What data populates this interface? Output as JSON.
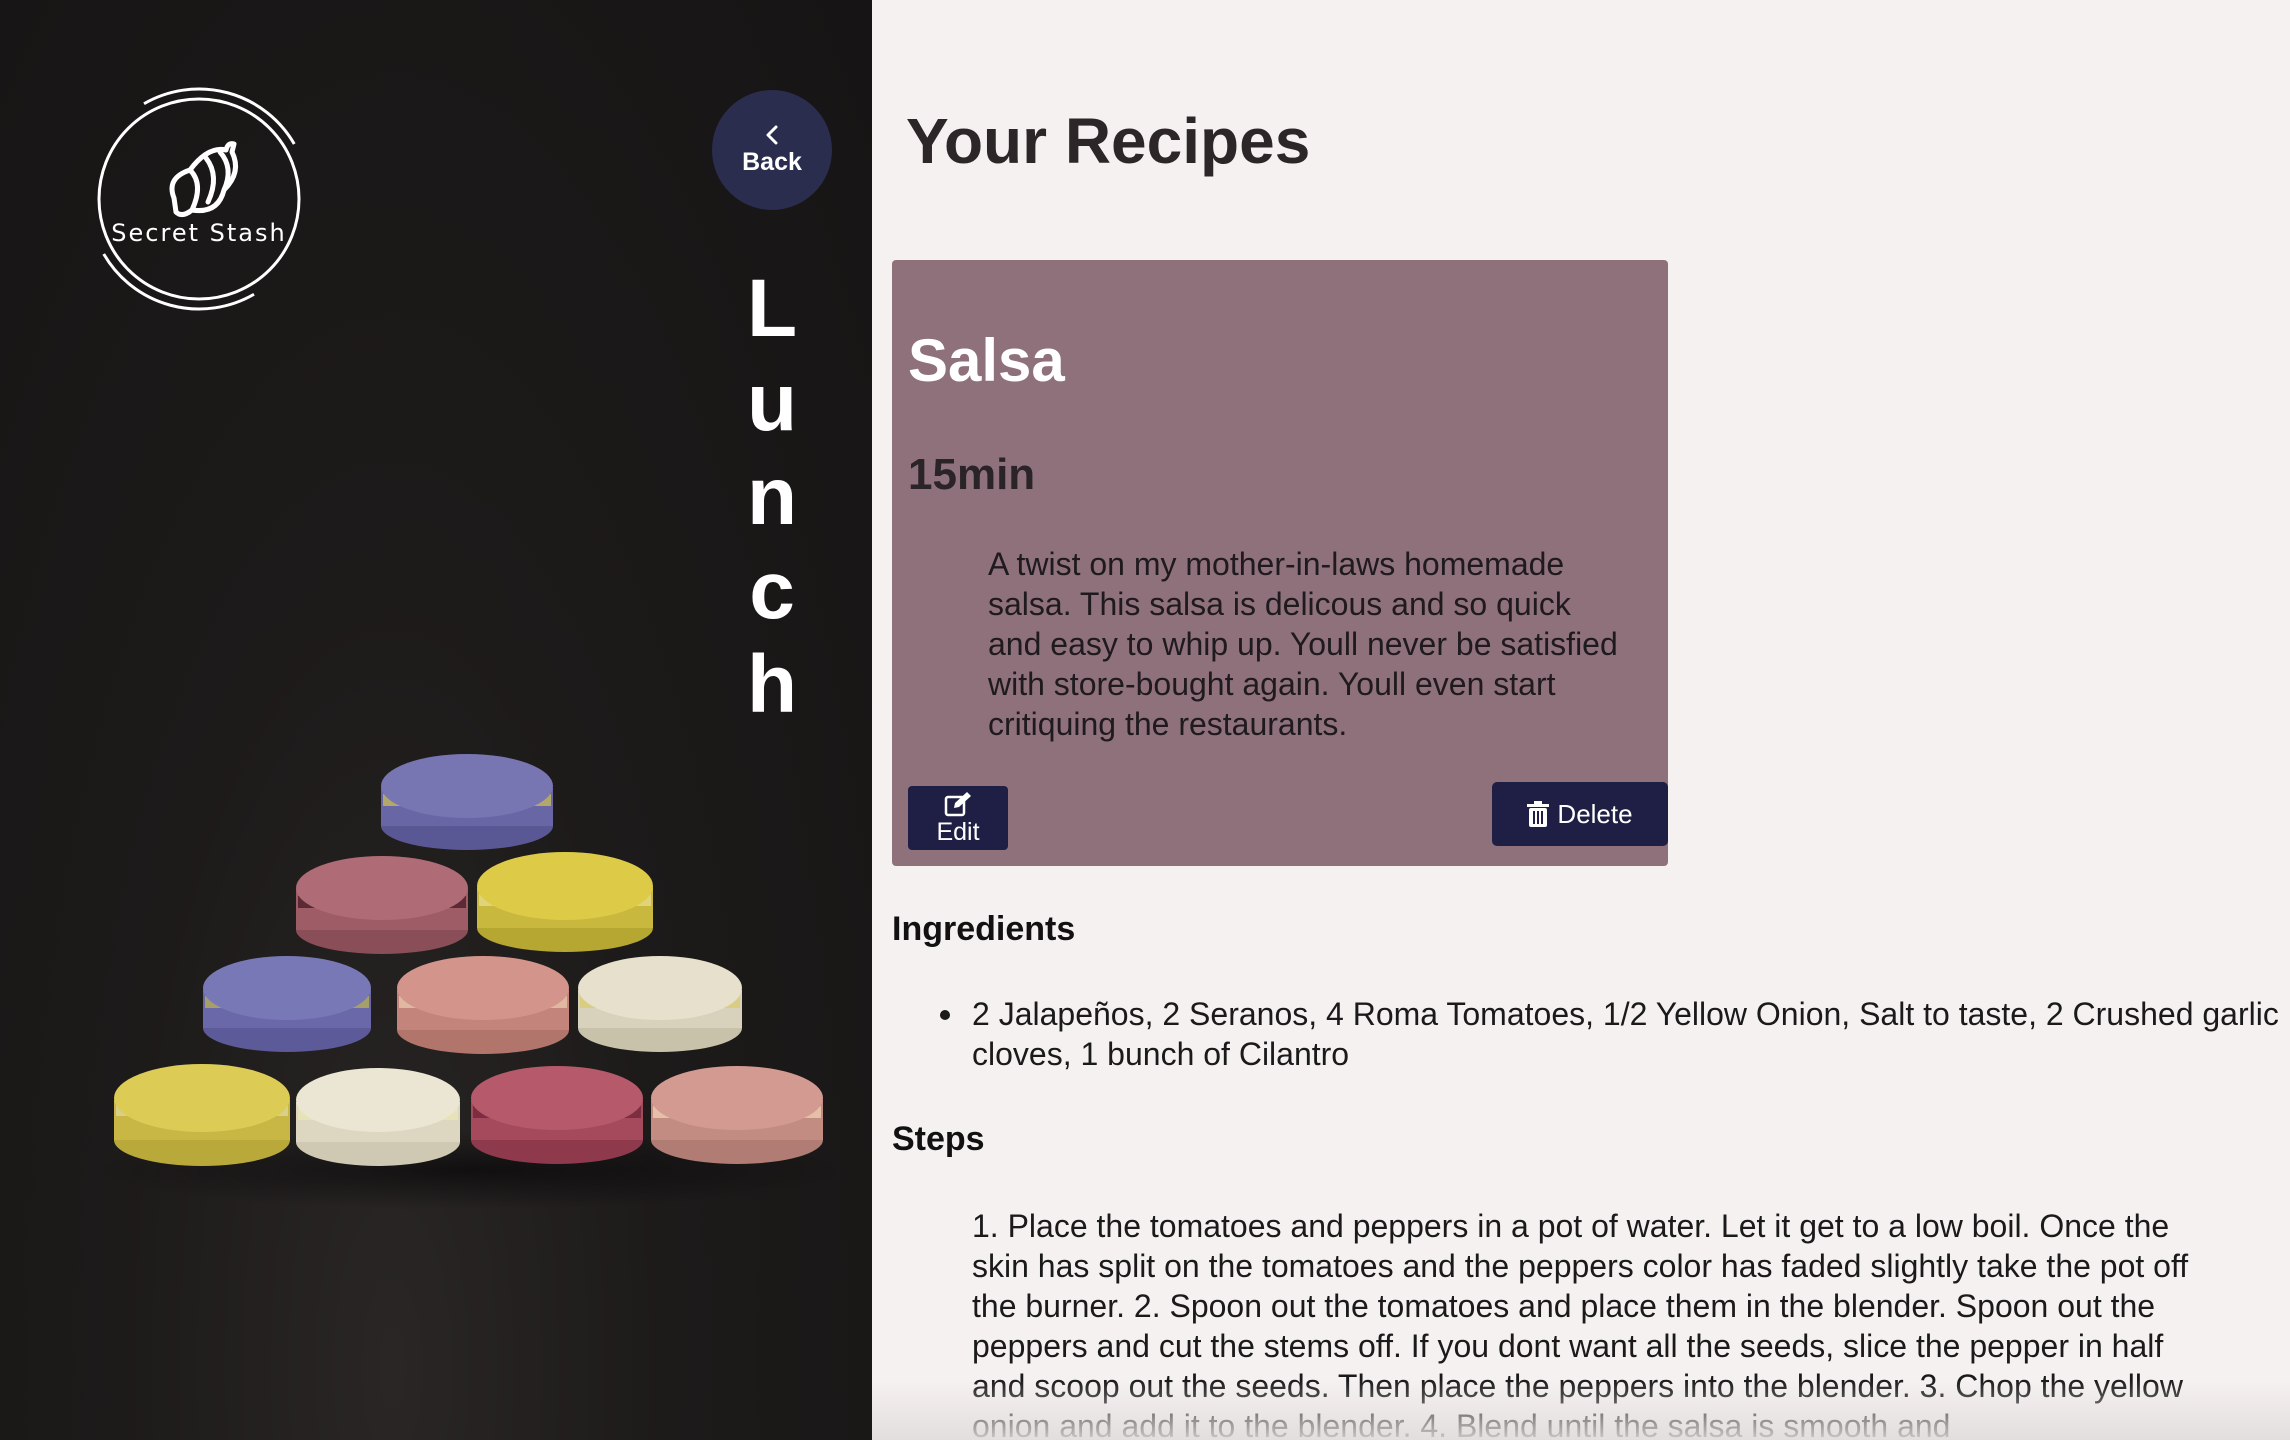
{
  "sidebar": {
    "logo_text": "Secret Stash",
    "back_label": "Back",
    "category_letters": [
      "L",
      "u",
      "n",
      "c",
      "h"
    ]
  },
  "main": {
    "title": "Your Recipes",
    "recipe": {
      "name": "Salsa",
      "time": "15min",
      "description": "A twist on my mother-in-laws homemade salsa. This salsa is delicous and so quick and easy to whip up. Youll never be satisfied with store-bought again. Youll even start critiquing the restaurants.",
      "edit_label": "Edit",
      "delete_label": "Delete"
    },
    "ingredients_heading": "Ingredients",
    "ingredients": [
      "2 Jalapeños, 2 Seranos, 4 Roma Tomatoes, 1/2 Yellow Onion, Salt to taste, 2 Crushed garlic cloves, 1 bunch of Cilantro"
    ],
    "steps_heading": "Steps",
    "steps": "1. Place the tomatoes and peppers in a pot of water. Let it get to a low boil. Once the skin has split on the tomatoes and the peppers color has faded slightly take the pot off the burner. 2. Spoon out the tomatoes and place them in the blender. Spoon out the peppers and cut the stems off. If you dont want all the seeds, slice the pepper in half and scoop out the seeds. Then place the peppers into the blender. 3. Chop the yellow onion and add it to the blender. 4. Blend until the salsa is smooth and"
  },
  "colors": {
    "sidebar_bg": "#1a1717",
    "content_bg": "#f6f1f1",
    "card_bg": "#8f717b",
    "button_navy": "#1f1f45",
    "back_button_bg": "#2b2d4e"
  },
  "icons": {
    "logo": "croissant-icon",
    "back": "chevron-left-icon",
    "edit": "edit-icon",
    "delete": "trash-icon"
  }
}
